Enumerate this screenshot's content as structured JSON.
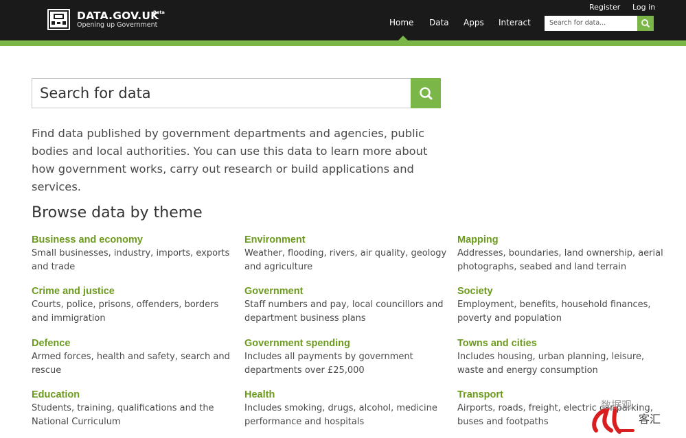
{
  "header": {
    "brand_title": "DATA.GOV.UK",
    "brand_beta": "Beta",
    "brand_sub": "Opening up Government",
    "register": "Register",
    "login": "Log in",
    "nav": [
      "Home",
      "Data",
      "Apps",
      "Interact"
    ],
    "search_placeholder": "Search for data...",
    "colors": {
      "bar": "#1a1a1a",
      "accent": "#7ab648"
    }
  },
  "main": {
    "search_placeholder": "Search for data",
    "intro": "Find data published by government departments and agencies, public bodies and local authorities. You can use this data to learn more about how government works, carry out research or build applications and services.",
    "browse_heading": "Browse data by theme",
    "themes": [
      {
        "title": "Business and economy",
        "desc": "Small businesses, industry, imports, exports and trade"
      },
      {
        "title": "Environment",
        "desc": "Weather, flooding, rivers, air quality, geology and agriculture"
      },
      {
        "title": "Mapping",
        "desc": "Addresses, boundaries, land ownership, aerial photographs, seabed and land terrain"
      },
      {
        "title": "Crime and justice",
        "desc": "Courts, police, prisons, offenders, borders and immigration"
      },
      {
        "title": "Government",
        "desc": "Staff numbers and pay, local councillors and department business plans"
      },
      {
        "title": "Society",
        "desc": "Employment, benefits, household finances, poverty and population"
      },
      {
        "title": "Defence",
        "desc": "Armed forces, health and safety, search and rescue"
      },
      {
        "title": "Government spending",
        "desc": "Includes all payments by government departments over £25,000"
      },
      {
        "title": "Towns and cities",
        "desc": "Includes housing, urban planning, leisure, waste and energy consumption"
      },
      {
        "title": "Education",
        "desc": "Students, training, qualifications and the National Curriculum"
      },
      {
        "title": "Health",
        "desc": "Includes smoking, drugs, alcohol, medicine performance and hospitals"
      },
      {
        "title": "Transport",
        "desc": "Airports, roads, freight, electric car parking, buses and footpaths"
      }
    ],
    "theme_color": "#6c9a1d"
  },
  "watermark": {
    "line1": "数据观",
    "line2": "客汇"
  }
}
